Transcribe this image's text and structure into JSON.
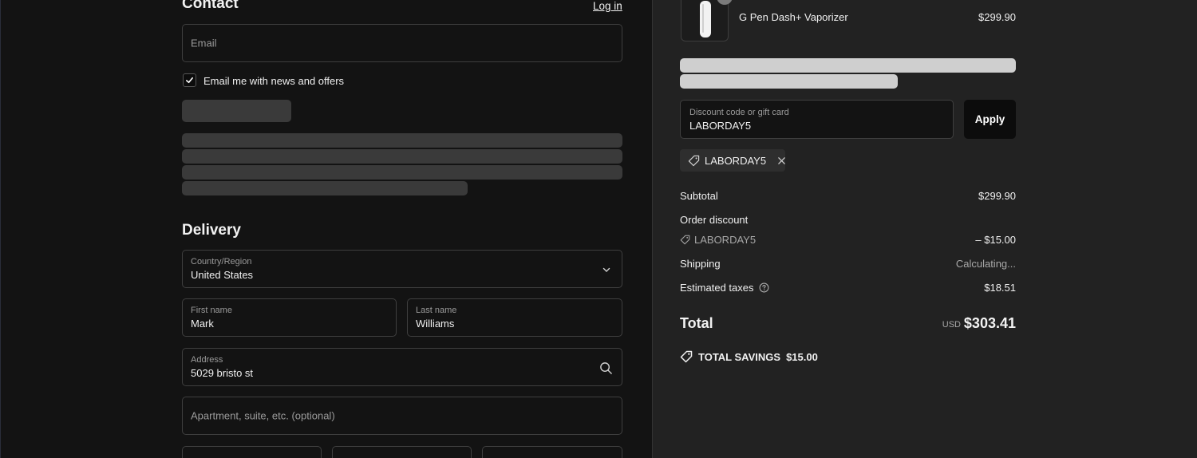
{
  "contact": {
    "heading": "Contact",
    "login_link": "Log in",
    "email_placeholder": "Email",
    "newsletter_label": "Email me with news and offers",
    "newsletter_checked": true
  },
  "delivery": {
    "heading": "Delivery",
    "country": {
      "label": "Country/Region",
      "value": "United States"
    },
    "first_name": {
      "label": "First name",
      "value": "Mark"
    },
    "last_name": {
      "label": "Last name",
      "value": "Williams"
    },
    "address": {
      "label": "Address",
      "value": "5029 bristo st"
    },
    "apartment_placeholder": "Apartment, suite, etc. (optional)"
  },
  "summary": {
    "product": {
      "name": "G Pen Dash+ Vaporizer",
      "price": "$299.90"
    },
    "discount": {
      "label": "Discount code or gift card",
      "value": "LABORDAY5",
      "apply_label": "Apply"
    },
    "applied_code": "LABORDAY5",
    "subtotal": {
      "label": "Subtotal",
      "value": "$299.90"
    },
    "order_discount": {
      "label": "Order discount",
      "code": "LABORDAY5",
      "value": "– $15.00"
    },
    "shipping": {
      "label": "Shipping",
      "value": "Calculating..."
    },
    "taxes": {
      "label": "Estimated taxes",
      "value": "$18.51"
    },
    "total": {
      "label": "Total",
      "currency": "USD",
      "value": "$303.41"
    },
    "savings": {
      "label": "TOTAL SAVINGS",
      "value": "$15.00"
    }
  },
  "colors": {
    "left_bg": "#131313",
    "right_bg": "#222222",
    "field_border": "#3f3f3f",
    "apply_bg": "#0c0c0c"
  }
}
